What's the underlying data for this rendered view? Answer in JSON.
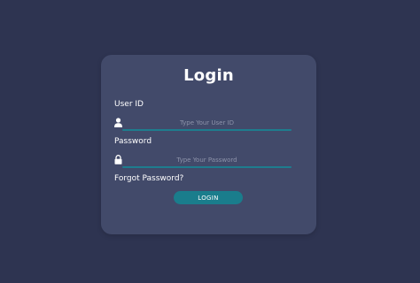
{
  "form": {
    "title": "Login",
    "user_id": {
      "label": "User ID",
      "placeholder": "Type Your User ID",
      "value": ""
    },
    "password": {
      "label": "Password",
      "placeholder": "Type Your Password",
      "value": ""
    },
    "forgot_label": "Forgot Password?",
    "submit_label": "LOGIN"
  },
  "icons": {
    "user": "user-icon",
    "password": "lock-icon"
  },
  "colors": {
    "page_background": "#2e3451",
    "card_background": "#424a6a",
    "accent": "#1a7d8c",
    "text": "#ffffff",
    "placeholder": "#8d93aa"
  }
}
